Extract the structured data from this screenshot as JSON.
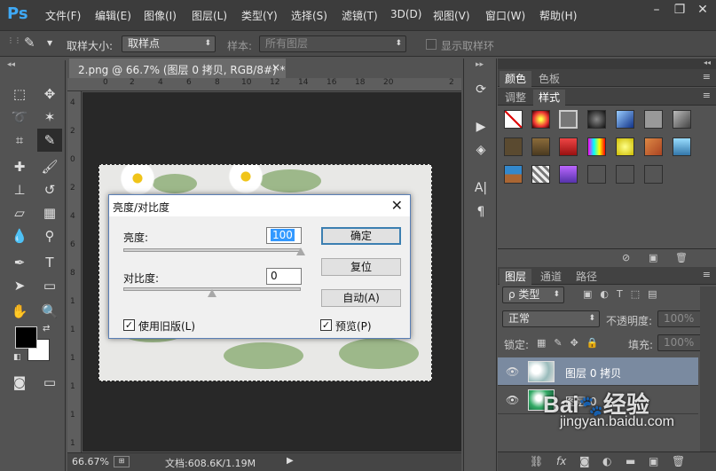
{
  "menubar": {
    "logo": "Ps",
    "items": [
      "文件(F)",
      "编辑(E)",
      "图像(I)",
      "图层(L)",
      "类型(Y)",
      "选择(S)",
      "滤镜(T)",
      "3D(D)",
      "视图(V)",
      "窗口(W)",
      "帮助(H)"
    ]
  },
  "options": {
    "sample_size_label": "取样大小:",
    "sample_size_value": "取样点",
    "sample_label": "样本:",
    "sample_value": "所有图层",
    "show_ring_label": "显示取样环"
  },
  "document": {
    "tab_title": "2.png @ 66.7% (图层 0 拷贝, RGB/8#) *",
    "close": "×",
    "ruler_top": [
      "0",
      "2",
      "4",
      "6",
      "8",
      "10",
      "12",
      "14",
      "16",
      "18",
      "20",
      "2"
    ],
    "ruler_left": [
      "4",
      "2",
      "0",
      "2",
      "4",
      "6",
      "8",
      "1",
      "1",
      "1",
      "1",
      "1",
      "1"
    ]
  },
  "status": {
    "zoom": "66.67%",
    "doc_info": "文档:608.6K/1.19M"
  },
  "dialog": {
    "title": "亮度/对比度",
    "close": "✕",
    "brightness_label": "亮度:",
    "brightness_value": "100",
    "brightness_level": 1.0,
    "contrast_label": "对比度:",
    "contrast_value": "0",
    "contrast_level": 0.5,
    "ok_label": "确定",
    "reset_label": "复位",
    "auto_label": "自动(A)",
    "legacy_label": "使用旧版(L)",
    "legacy_checked": true,
    "preview_label": "预览(P)",
    "preview_checked": true
  },
  "panels": {
    "top_tabs": [
      "颜色",
      "色板"
    ],
    "style_tabs": [
      "调整",
      "样式"
    ],
    "layer_tabs": [
      "图层",
      "通道",
      "路径"
    ],
    "filter_type": "ρ 类型",
    "blend_mode": "正常",
    "opacity_label": "不透明度:",
    "opacity_value": "100%",
    "lock_label": "锁定:",
    "fill_label": "填充:",
    "fill_value": "100%",
    "layers": [
      {
        "name": "图层 0 拷贝",
        "selected": true
      },
      {
        "name": "图层 0",
        "selected": false
      }
    ],
    "footer_icons": [
      "link-icon",
      "fx-icon",
      "mask-icon",
      "adjustment-icon",
      "folder-icon",
      "new-layer-icon",
      "trash-icon"
    ]
  },
  "watermark": {
    "text": "jingyan.baidu.com"
  },
  "colors": {
    "accent": "#3fa9f5",
    "selected_layer": "#7a8aa0",
    "dialog_default_border": "#3c7fb1"
  }
}
